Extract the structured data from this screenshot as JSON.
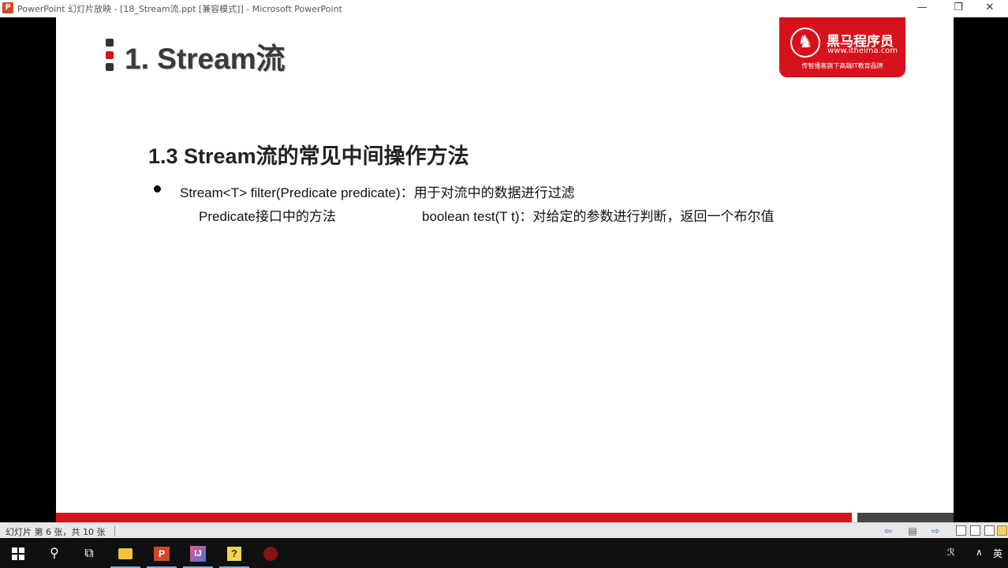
{
  "window": {
    "app_icon": "P",
    "title": "PowerPoint 幻灯片放映 - [18_Stream流.ppt [兼容模式]] - Microsoft PowerPoint",
    "min_glyph": "—",
    "restore_glyph": "❐",
    "close_glyph": "✕"
  },
  "slide": {
    "title": "1. Stream流",
    "logo": {
      "horse_glyph": "♞",
      "name": "黑马程序员",
      "url": "www.itheima.com",
      "tagline": "传智播客旗下高端IT教育品牌"
    },
    "subtitle": "1.3 Stream流的常见中间操作方法",
    "bullet1": "Stream<T> filter(Predicate predicate)：用于对流中的数据进行过滤",
    "line2_left": "Predicate接口中的方法",
    "line2_right": "boolean test(T t)：对给定的参数进行判断，返回一个布尔值"
  },
  "statusbar": {
    "slide_count": "幻灯片 第 6 张，共 10 张"
  },
  "taskbar": {
    "tray_person": "ℛ",
    "tray_caret": "∧",
    "ime": "英"
  },
  "colors": {
    "accent_red": "#d4121a",
    "logo_red": "#d6121c"
  }
}
